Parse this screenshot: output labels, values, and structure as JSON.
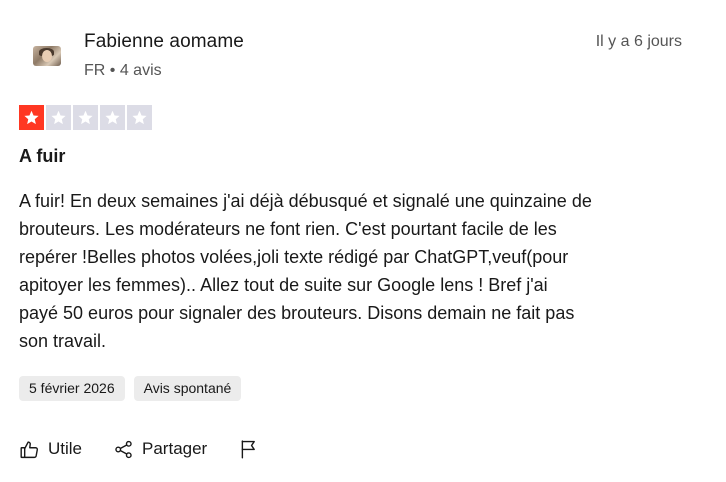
{
  "reviewer": {
    "name": "Fabienne aomame",
    "meta": "FR • 4 avis",
    "relative_date": "Il y a 6 jours"
  },
  "rating": {
    "stars": 1,
    "max": 5,
    "filled_color": "#ff3722",
    "empty_color": "#dcdce6"
  },
  "review": {
    "title": "A fuir",
    "body_lines": [
      "A fuir! En deux semaines j'ai déjà débusqué et signalé une quinzaine de",
      "brouteurs. Les modérateurs ne font rien. C'est pourtant facile de les",
      "repérer !Belles photos volées,joli texte rédigé par ChatGPT,veuf(pour",
      "apitoyer les femmes).. Allez tout de suite sur Google lens ! Bref j'ai",
      "payé 50 euros pour signaler des brouteurs. Disons demain ne fait pas",
      "son travail."
    ]
  },
  "tags": {
    "date": "5 février 2026",
    "type": "Avis spontané"
  },
  "actions": {
    "useful_label": "Utile",
    "useful_icon": "thumbs-up-icon",
    "share_label": "Partager",
    "share_icon": "share-icon",
    "report_icon": "flag-icon"
  }
}
